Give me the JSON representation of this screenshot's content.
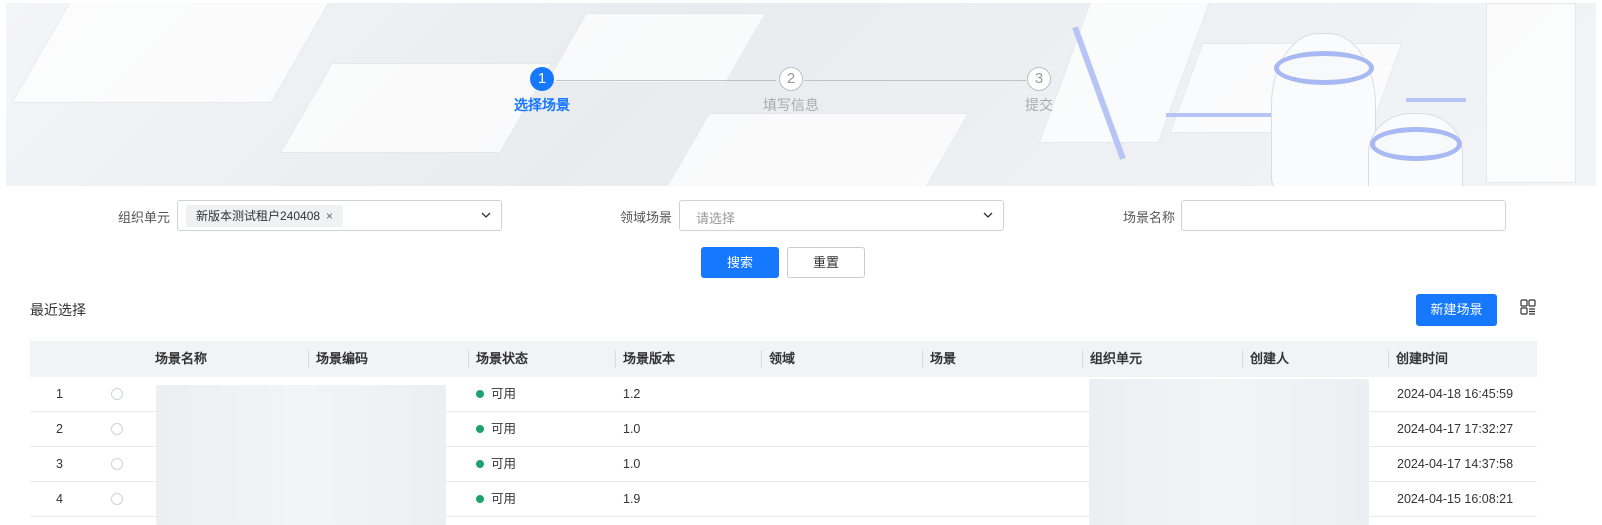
{
  "steps": [
    {
      "number": "1",
      "label": "选择场景",
      "active": true
    },
    {
      "number": "2",
      "label": "填写信息",
      "active": false
    },
    {
      "number": "3",
      "label": "提交",
      "active": false
    }
  ],
  "filters": {
    "org_label": "组织单元",
    "org_tag": "新版本测试租户240408",
    "org_tag_close": "×",
    "domain_label": "领域场景",
    "domain_placeholder": "请选择",
    "name_label": "场景名称",
    "name_value": ""
  },
  "actions": {
    "search": "搜索",
    "reset": "重置",
    "new_scene": "新建场景"
  },
  "section_title": "最近选择",
  "table": {
    "columns": [
      "场景名称",
      "场景编码",
      "场景状态",
      "场景版本",
      "领域",
      "场景",
      "组织单元",
      "创建人",
      "创建时间"
    ],
    "rows": [
      {
        "index": "1",
        "status": "可用",
        "version": "1.2",
        "created": "2024-04-18 16:45:59"
      },
      {
        "index": "2",
        "status": "可用",
        "version": "1.0",
        "created": "2024-04-17 17:32:27"
      },
      {
        "index": "3",
        "status": "可用",
        "version": "1.0",
        "created": "2024-04-17 14:37:58"
      },
      {
        "index": "4",
        "status": "可用",
        "version": "1.9",
        "created": "2024-04-15 16:08:21"
      }
    ]
  },
  "colors": {
    "primary": "#1677ff",
    "status_available": "#1aa36b"
  },
  "icons": {
    "dropdown": "chevron-down-icon",
    "view_toggle": "grid-view-icon",
    "tag_close": "close-icon"
  }
}
